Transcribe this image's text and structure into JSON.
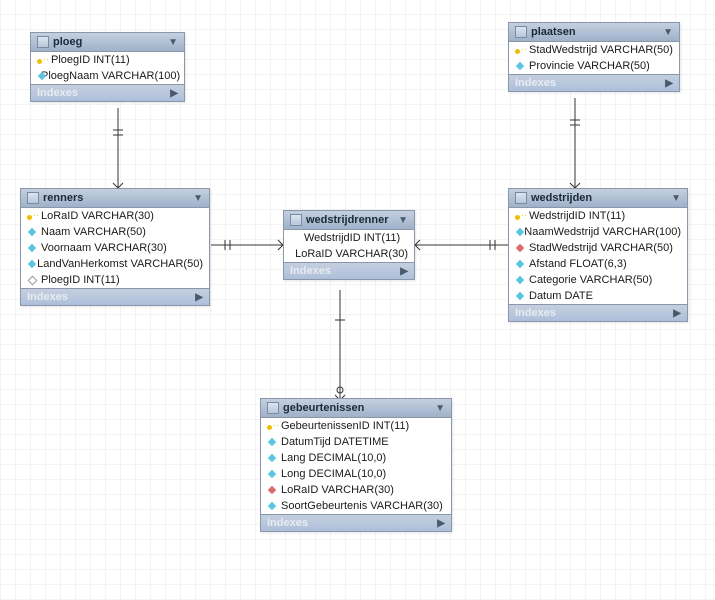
{
  "indexes_label": "Indexes",
  "tables": {
    "ploeg": {
      "title": "ploeg",
      "cols": [
        {
          "icon": "key",
          "text": "PloegID INT(11)"
        },
        {
          "icon": "diamond-blue",
          "text": "PloegNaam VARCHAR(100)"
        }
      ]
    },
    "plaatsen": {
      "title": "plaatsen",
      "cols": [
        {
          "icon": "key",
          "text": "StadWedstrijd VARCHAR(50)"
        },
        {
          "icon": "diamond-blue",
          "text": "Provincie VARCHAR(50)"
        }
      ]
    },
    "renners": {
      "title": "renners",
      "cols": [
        {
          "icon": "key",
          "text": "LoRaID VARCHAR(30)"
        },
        {
          "icon": "diamond-blue",
          "text": "Naam VARCHAR(50)"
        },
        {
          "icon": "diamond-blue",
          "text": "Voornaam VARCHAR(30)"
        },
        {
          "icon": "diamond-blue",
          "text": "LandVanHerkomst VARCHAR(50)"
        },
        {
          "icon": "diamond-hollow",
          "text": "PloegID INT(11)"
        }
      ]
    },
    "wedstrijdrenner": {
      "title": "wedstrijdrenner",
      "cols": [
        {
          "icon": "",
          "text": "WedstrijdID INT(11)"
        },
        {
          "icon": "",
          "text": "LoRaID VARCHAR(30)"
        }
      ]
    },
    "wedstrijden": {
      "title": "wedstrijden",
      "cols": [
        {
          "icon": "key",
          "text": "WedstrijdID INT(11)"
        },
        {
          "icon": "diamond-blue",
          "text": "NaamWedstrijd VARCHAR(100)"
        },
        {
          "icon": "diamond-red",
          "text": "StadWedstrijd VARCHAR(50)"
        },
        {
          "icon": "diamond-blue",
          "text": "Afstand FLOAT(6,3)"
        },
        {
          "icon": "diamond-blue",
          "text": "Categorie VARCHAR(50)"
        },
        {
          "icon": "diamond-blue",
          "text": "Datum DATE"
        }
      ]
    },
    "gebeurtenissen": {
      "title": "gebeurtenissen",
      "cols": [
        {
          "icon": "key",
          "text": "GebeurtenissenID INT(11)"
        },
        {
          "icon": "diamond-blue",
          "text": "DatumTijd DATETIME"
        },
        {
          "icon": "diamond-blue",
          "text": "Lang DECIMAL(10,0)"
        },
        {
          "icon": "diamond-blue",
          "text": "Long DECIMAL(10,0)"
        },
        {
          "icon": "diamond-red",
          "text": "LoRaID VARCHAR(30)"
        },
        {
          "icon": "diamond-blue",
          "text": "SoortGebeurtenis VARCHAR(30)"
        }
      ]
    }
  },
  "chart_data": {
    "type": "table",
    "description": "Entity-relationship diagram (database schema)",
    "entities": [
      {
        "name": "ploeg",
        "columns": [
          {
            "name": "PloegID",
            "type": "INT(11)",
            "pk": true
          },
          {
            "name": "PloegNaam",
            "type": "VARCHAR(100)"
          }
        ]
      },
      {
        "name": "plaatsen",
        "columns": [
          {
            "name": "StadWedstrijd",
            "type": "VARCHAR(50)",
            "pk": true
          },
          {
            "name": "Provincie",
            "type": "VARCHAR(50)"
          }
        ]
      },
      {
        "name": "renners",
        "columns": [
          {
            "name": "LoRaID",
            "type": "VARCHAR(30)",
            "pk": true
          },
          {
            "name": "Naam",
            "type": "VARCHAR(50)"
          },
          {
            "name": "Voornaam",
            "type": "VARCHAR(30)"
          },
          {
            "name": "LandVanHerkomst",
            "type": "VARCHAR(50)"
          },
          {
            "name": "PloegID",
            "type": "INT(11)",
            "fk": "ploeg.PloegID"
          }
        ]
      },
      {
        "name": "wedstrijdrenner",
        "columns": [
          {
            "name": "WedstrijdID",
            "type": "INT(11)",
            "fk": "wedstrijden.WedstrijdID"
          },
          {
            "name": "LoRaID",
            "type": "VARCHAR(30)",
            "fk": "renners.LoRaID"
          }
        ]
      },
      {
        "name": "wedstrijden",
        "columns": [
          {
            "name": "WedstrijdID",
            "type": "INT(11)",
            "pk": true
          },
          {
            "name": "NaamWedstrijd",
            "type": "VARCHAR(100)"
          },
          {
            "name": "StadWedstrijd",
            "type": "VARCHAR(50)",
            "fk": "plaatsen.StadWedstrijd"
          },
          {
            "name": "Afstand",
            "type": "FLOAT(6,3)"
          },
          {
            "name": "Categorie",
            "type": "VARCHAR(50)"
          },
          {
            "name": "Datum",
            "type": "DATE"
          }
        ]
      },
      {
        "name": "gebeurtenissen",
        "columns": [
          {
            "name": "GebeurtenissenID",
            "type": "INT(11)",
            "pk": true
          },
          {
            "name": "DatumTijd",
            "type": "DATETIME"
          },
          {
            "name": "Lang",
            "type": "DECIMAL(10,0)"
          },
          {
            "name": "Long",
            "type": "DECIMAL(10,0)"
          },
          {
            "name": "LoRaID",
            "type": "VARCHAR(30)",
            "fk": "renners.LoRaID"
          },
          {
            "name": "SoortGebeurtenis",
            "type": "VARCHAR(30)"
          }
        ]
      }
    ],
    "relationships": [
      {
        "from": "ploeg",
        "to": "renners",
        "type": "one-to-many"
      },
      {
        "from": "renners",
        "to": "wedstrijdrenner",
        "type": "one-to-many"
      },
      {
        "from": "wedstrijden",
        "to": "wedstrijdrenner",
        "type": "one-to-many"
      },
      {
        "from": "plaatsen",
        "to": "wedstrijden",
        "type": "one-to-many"
      },
      {
        "from": "wedstrijdrenner",
        "to": "gebeurtenissen",
        "type": "one-to-many"
      }
    ]
  }
}
